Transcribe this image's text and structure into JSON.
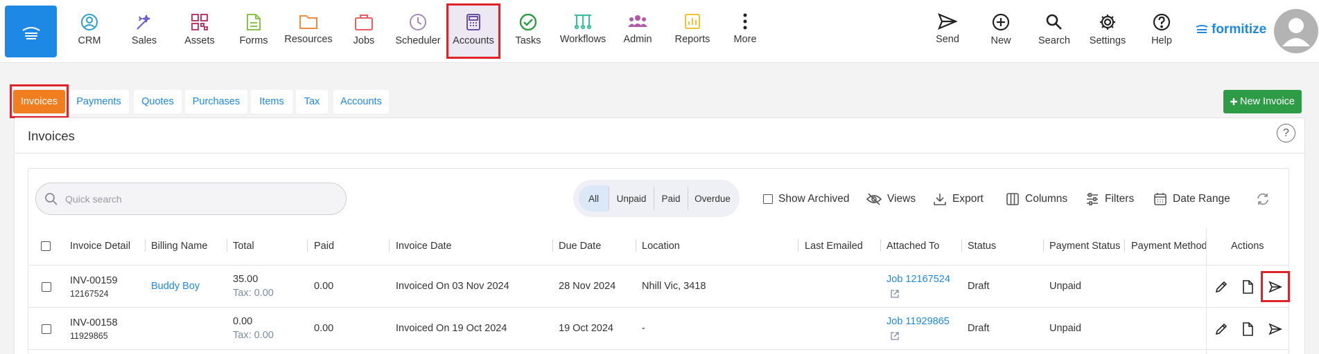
{
  "nav": {
    "home_icon": "home-icon",
    "items": [
      {
        "label": "CRM",
        "icon": "crm-icon",
        "color": "#2a9fd6"
      },
      {
        "label": "Sales",
        "icon": "sales-icon",
        "color": "#6a5acd"
      },
      {
        "label": "Assets",
        "icon": "assets-icon",
        "color": "#c0396b"
      },
      {
        "label": "Forms",
        "icon": "forms-icon",
        "color": "#8bc34a"
      },
      {
        "label": "Resources",
        "icon": "folder-icon",
        "color": "#f08a3c"
      },
      {
        "label": "Jobs",
        "icon": "briefcase-icon",
        "color": "#e85d5d"
      },
      {
        "label": "Scheduler",
        "icon": "clock-icon",
        "color": "#a58ab8"
      },
      {
        "label": "Accounts",
        "icon": "calculator-icon",
        "color": "#6b4fa3"
      },
      {
        "label": "Tasks",
        "icon": "check-circle-icon",
        "color": "#2e9b46"
      },
      {
        "label": "Workflows",
        "icon": "workflow-icon",
        "color": "#3fbf9f"
      },
      {
        "label": "Admin",
        "icon": "people-icon",
        "color": "#b05aa8"
      },
      {
        "label": "Reports",
        "icon": "chart-icon",
        "color": "#f2c12e"
      },
      {
        "label": "More",
        "icon": "more-vertical-icon",
        "color": "#222222"
      }
    ],
    "right_items": [
      {
        "label": "Send",
        "icon": "send-icon"
      },
      {
        "label": "New",
        "icon": "plus-circle-icon"
      },
      {
        "label": "Search",
        "icon": "search-icon"
      },
      {
        "label": "Settings",
        "icon": "gear-icon"
      },
      {
        "label": "Help",
        "icon": "help-icon"
      }
    ],
    "brand": "formitize",
    "accent": "#1e88e5",
    "highlight": "#e0232a"
  },
  "subtabs": [
    "Invoices",
    "Payments",
    "Quotes",
    "Purchases",
    "Items",
    "Tax",
    "Accounts"
  ],
  "new_invoice_label": "New Invoice",
  "panel": {
    "title": "Invoices",
    "help": "?"
  },
  "toolbar": {
    "search_placeholder": "Quick search",
    "filters": [
      "All",
      "Unpaid",
      "Paid",
      "Overdue"
    ],
    "show_archived": "Show Archived",
    "views": "Views",
    "export": "Export",
    "columns": "Columns",
    "filters_label": "Filters",
    "date_range": "Date Range"
  },
  "table": {
    "headers": [
      "Invoice Detail",
      "Billing Name",
      "Total",
      "Paid",
      "Invoice Date",
      "Due Date",
      "Location",
      "Last Emailed",
      "Attached To",
      "Status",
      "Payment Status",
      "Payment Method",
      "Actions"
    ],
    "rows": [
      {
        "number": "INV-00159",
        "ref": "12167524",
        "billing": "Buddy Boy",
        "total": "35.00",
        "tax": "Tax: 0.00",
        "paid": "0.00",
        "invoice_date": "Invoiced On 03 Nov 2024",
        "due": "28 Nov 2024",
        "location": "Nhill Vic, 3418",
        "attached": "Job 12167524",
        "status": "Draft",
        "payment_status": "Unpaid"
      },
      {
        "number": "INV-00158",
        "ref": "11929865",
        "billing": "",
        "total": "0.00",
        "tax": "Tax: 0.00",
        "paid": "0.00",
        "invoice_date": "Invoiced On 19 Oct 2024",
        "due": "19 Oct 2024",
        "location": "-",
        "attached": "Job 11929865",
        "status": "Draft",
        "payment_status": "Unpaid"
      }
    ]
  }
}
